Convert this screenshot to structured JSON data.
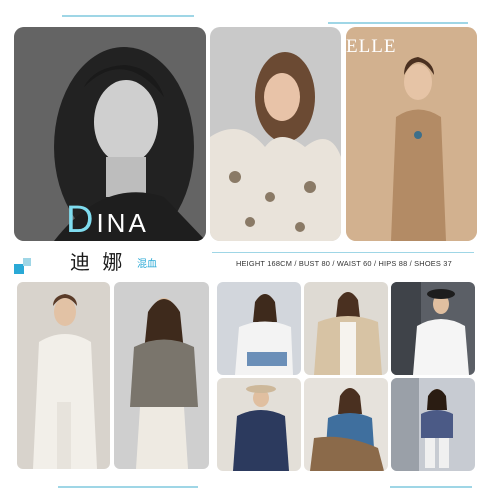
{
  "model": {
    "name_latin_first": "D",
    "name_latin_rest": "INA",
    "name_chinese": "迪 娜",
    "heritage": "混血",
    "measurements": "HEIGHT 168CM / BUST 80 / WAIST 60 / HIPS 88 / SHOES 37"
  },
  "magazine": {
    "logo": "ELLE"
  },
  "colors": {
    "accent": "#2aa9d6",
    "accent_light": "#9fd6e6",
    "background": "#ffffff"
  }
}
